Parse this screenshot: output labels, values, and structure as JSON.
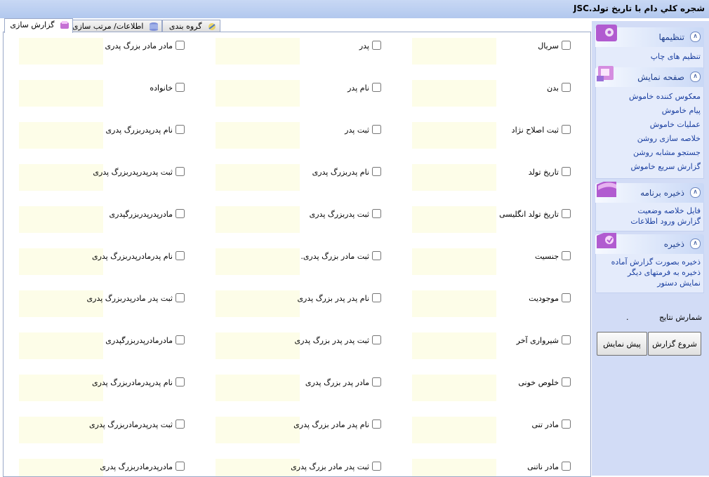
{
  "window": {
    "title": "شجره کلي دام با تاريخ تولد.JSC"
  },
  "tabs": [
    {
      "label": "گزارش سازی"
    },
    {
      "label": "اطلاعات/ مرتب سازی"
    },
    {
      "label": "گروه بندی"
    }
  ],
  "fields": {
    "col1": [
      "سریال",
      "بدن",
      "ثبت اصلاح نژاد",
      "تاریخ تولد",
      "تاریخ تولد انگلیسی",
      "جنسیت",
      "موجودیت",
      "شیرواری آخر",
      "خلوص خونی",
      "مادر تنی",
      "مادر ناتنی"
    ],
    "col2": [
      "پدر",
      "نام پدر",
      "ثبت پدر",
      "نام پدربزرگ پدری",
      "ثبت پدربزرگ پدری",
      "ثبت مادر بزرگ پدری.",
      "نام  پدر پدر بزرگ پدری",
      "ثبت پدر پدر بزرگ پدری",
      "مادر پدر بزرگ پدری",
      "نام پدر مادر بزرگ پدری",
      "ثبت پدر مادر بزرگ پدری"
    ],
    "col3": [
      "مادر مادر بزرگ پدری",
      "خانواده",
      "نام پدرپدربزرگ پدری",
      "ثبت پدرپدرپدربزرگ پدری",
      "مادرپدرپدربزرگپدری",
      "نام پدرمادرپدربزرگ پدری",
      "ثبت پدر مادرپدربزرگ پدری",
      "مادرمادرپدربزرگپدری",
      "نام پدرپدرمادربزرگ پدری",
      "ثبت پدرپدرمادربزرگ پدری",
      "مادرپدرمادربزرگ پدری"
    ]
  },
  "sidebar": {
    "groups": [
      {
        "title": "تنظیمها",
        "links": [
          "تنظیم های چاپ"
        ]
      },
      {
        "title": "صفحه نمایش",
        "links": [
          "معکوس کننده خاموش",
          "پیام خاموش",
          "عملیات خاموش",
          "خلاصه سازی روشن",
          "جستجو مشابه روشن",
          "گزارش سریع خاموش"
        ]
      },
      {
        "title": "ذخیره برنامه",
        "links": [
          "فایل خلاصه وضعیت",
          "گزارش ورود اطلاعات"
        ]
      },
      {
        "title": "ذخیره",
        "links": [
          "ذخیره بصورت گزارش آماده",
          "ذخیره به فرمتهای دیگر",
          "نمایش دستور"
        ]
      }
    ],
    "counter": {
      "label": "شمارش نتایج",
      "value": "."
    },
    "buttons": {
      "start": "شروع گزارش",
      "preview": "پیش نمایش"
    }
  },
  "colors": {
    "accent": "#1e3f8f",
    "sidebar_bg": "#d2dcf6",
    "field_bg": "#fdfde8"
  }
}
